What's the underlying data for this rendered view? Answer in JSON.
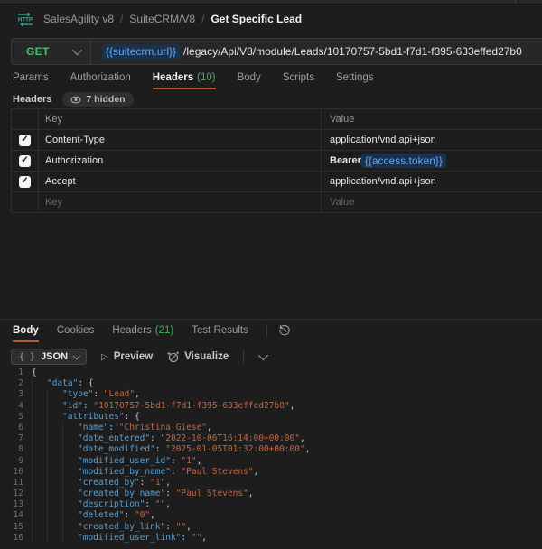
{
  "colors": {
    "accent_orange": "#b15a34",
    "get_green": "#4ac06a",
    "count_green": "#3fb950",
    "variable_blue": "#64a9ef",
    "json_key": "#5b9fcf",
    "json_string": "#c06744",
    "http_icon_teal": "#28b5a4"
  },
  "breadcrumb": {
    "items": [
      "SalesAgility v8",
      "SuiteCRM/V8"
    ],
    "current": "Get Specific Lead",
    "separator": "/"
  },
  "request": {
    "method": "GET",
    "url_parts": [
      [
        "v",
        "{{suitecrm.url}}"
      ],
      [
        "t",
        "/legacy/Api/V8/module/Leads/10170757-5bd1-f7d1-f395-633effed27b0"
      ]
    ],
    "tabs": [
      {
        "label": "Params"
      },
      {
        "label": "Authorization"
      },
      {
        "label": "Headers",
        "count": "(10)",
        "active": true
      },
      {
        "label": "Body"
      },
      {
        "label": "Scripts"
      },
      {
        "label": "Settings"
      }
    ],
    "headers_title": "Headers",
    "hidden_badge": "7 hidden",
    "table": {
      "columns": {
        "key": "Key",
        "value": "Value"
      },
      "rows": [
        {
          "checked": true,
          "key": "Content-Type",
          "value": [
            [
              "t",
              "application/vnd.api+json"
            ]
          ]
        },
        {
          "checked": true,
          "key": "Authorization",
          "value": [
            [
              "b",
              "Bearer "
            ],
            [
              "v",
              "{{access.token}}"
            ]
          ]
        },
        {
          "checked": true,
          "key": "Accept",
          "value": [
            [
              "t",
              "application/vnd.api+json"
            ]
          ]
        }
      ],
      "placeholder_row": {
        "key": "Key",
        "value": "Value"
      }
    }
  },
  "response": {
    "tabs": [
      {
        "label": "Body",
        "active": true
      },
      {
        "label": "Cookies"
      },
      {
        "label": "Headers",
        "count": "(21)"
      },
      {
        "label": "Test Results"
      }
    ],
    "toolbar": {
      "format_label": "JSON",
      "preview_label": "Preview",
      "visualize_label": "Visualize"
    },
    "code": {
      "lines": [
        {
          "n": "1",
          "indent": 0,
          "parts": [
            [
              "p",
              "{"
            ]
          ]
        },
        {
          "n": "2",
          "indent": 1,
          "parts": [
            [
              "k",
              "\"data\""
            ],
            [
              "p",
              ": {"
            ]
          ]
        },
        {
          "n": "3",
          "indent": 2,
          "parts": [
            [
              "k",
              "\"type\""
            ],
            [
              "p",
              ": "
            ],
            [
              "s",
              "\"Lead\""
            ],
            [
              "p",
              ","
            ]
          ]
        },
        {
          "n": "4",
          "indent": 2,
          "parts": [
            [
              "k",
              "\"id\""
            ],
            [
              "p",
              ": "
            ],
            [
              "s",
              "\"10170757-5bd1-f7d1-f395-633effed27b0\""
            ],
            [
              "p",
              ","
            ]
          ]
        },
        {
          "n": "5",
          "indent": 2,
          "parts": [
            [
              "k",
              "\"attributes\""
            ],
            [
              "p",
              ": {"
            ]
          ]
        },
        {
          "n": "6",
          "indent": 3,
          "parts": [
            [
              "k",
              "\"name\""
            ],
            [
              "p",
              ": "
            ],
            [
              "s",
              "\"Christina Giese\""
            ],
            [
              "p",
              ","
            ]
          ]
        },
        {
          "n": "7",
          "indent": 3,
          "parts": [
            [
              "k",
              "\"date_entered\""
            ],
            [
              "p",
              ": "
            ],
            [
              "s",
              "\"2022-10-06T16:14:00+00:00\""
            ],
            [
              "p",
              ","
            ]
          ]
        },
        {
          "n": "8",
          "indent": 3,
          "parts": [
            [
              "k",
              "\"date_modified\""
            ],
            [
              "p",
              ": "
            ],
            [
              "s",
              "\"2025-01-05T01:32:00+00:00\""
            ],
            [
              "p",
              ","
            ]
          ]
        },
        {
          "n": "9",
          "indent": 3,
          "parts": [
            [
              "k",
              "\"modified_user_id\""
            ],
            [
              "p",
              ": "
            ],
            [
              "s",
              "\"1\""
            ],
            [
              "p",
              ","
            ]
          ]
        },
        {
          "n": "10",
          "indent": 3,
          "parts": [
            [
              "k",
              "\"modified_by_name\""
            ],
            [
              "p",
              ": "
            ],
            [
              "s",
              "\"Paul Stevens\""
            ],
            [
              "p",
              ","
            ]
          ]
        },
        {
          "n": "11",
          "indent": 3,
          "parts": [
            [
              "k",
              "\"created_by\""
            ],
            [
              "p",
              ": "
            ],
            [
              "s",
              "\"1\""
            ],
            [
              "p",
              ","
            ]
          ]
        },
        {
          "n": "12",
          "indent": 3,
          "parts": [
            [
              "k",
              "\"created_by_name\""
            ],
            [
              "p",
              ": "
            ],
            [
              "s",
              "\"Paul Stevens\""
            ],
            [
              "p",
              ","
            ]
          ]
        },
        {
          "n": "13",
          "indent": 3,
          "parts": [
            [
              "k",
              "\"description\""
            ],
            [
              "p",
              ": "
            ],
            [
              "s",
              "\"\""
            ],
            [
              "p",
              ","
            ]
          ]
        },
        {
          "n": "14",
          "indent": 3,
          "parts": [
            [
              "k",
              "\"deleted\""
            ],
            [
              "p",
              ": "
            ],
            [
              "s",
              "\"0\""
            ],
            [
              "p",
              ","
            ]
          ]
        },
        {
          "n": "15",
          "indent": 3,
          "parts": [
            [
              "k",
              "\"created_by_link\""
            ],
            [
              "p",
              ": "
            ],
            [
              "s",
              "\"\""
            ],
            [
              "p",
              ","
            ]
          ]
        },
        {
          "n": "16",
          "indent": 3,
          "parts": [
            [
              "k",
              "\"modified_user_link\""
            ],
            [
              "p",
              ": "
            ],
            [
              "s",
              "\"\""
            ],
            [
              "p",
              ","
            ]
          ]
        }
      ]
    }
  }
}
